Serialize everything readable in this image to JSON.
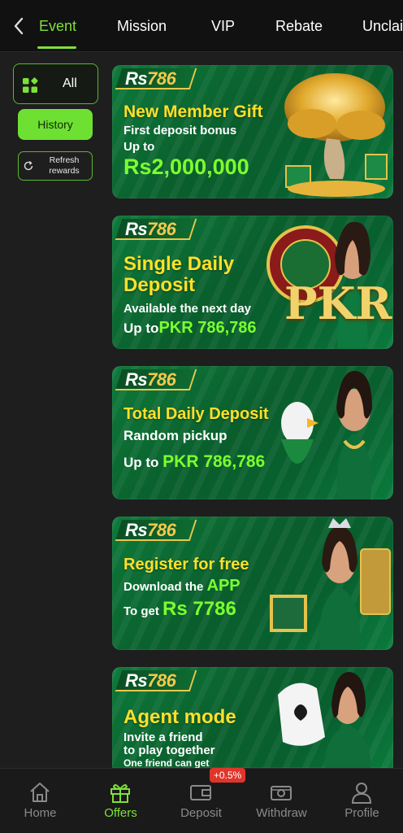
{
  "tabs": [
    {
      "label": "Event",
      "active": true
    },
    {
      "label": "Mission",
      "active": false
    },
    {
      "label": "VIP",
      "active": false
    },
    {
      "label": "Rebate",
      "active": false
    },
    {
      "label": "Unclai",
      "active": false
    }
  ],
  "filters": {
    "all_label": "All",
    "history_label": "History",
    "refresh_label": "Refresh rewards"
  },
  "brand": {
    "prefix": "Rs",
    "number": "786"
  },
  "banners": [
    {
      "title": "New Member Gift",
      "line1": "First deposit bonus",
      "line2": "Up to",
      "amount": "Rs2,000,000"
    },
    {
      "title1": "Single Daily",
      "title2": "Deposit",
      "line1": "Available the next day",
      "line2_prefix": "Up to",
      "amount": "PKR 786,786",
      "art_text": "PKR"
    },
    {
      "title": "Total Daily Deposit",
      "line1": "Random pickup",
      "line2_prefix": "Up to ",
      "amount": "PKR 786,786"
    },
    {
      "title": "Register for free",
      "line1_prefix": "Download the ",
      "line1_green": "APP",
      "line2_prefix": "To get ",
      "amount": "Rs 7786"
    },
    {
      "title": "Agent mode",
      "line1": "Invite a friend",
      "line2": "to play together",
      "line3": "One friend can get"
    }
  ],
  "bottom_nav": [
    {
      "label": "Home",
      "icon": "home-icon",
      "active": false
    },
    {
      "label": "Offers",
      "icon": "gift-icon",
      "active": true
    },
    {
      "label": "Deposit",
      "icon": "wallet-icon",
      "active": false
    },
    {
      "label": "Withdraw",
      "icon": "cash-icon",
      "active": false
    },
    {
      "label": "Profile",
      "icon": "person-icon",
      "active": false
    }
  ],
  "deposit_badge": "+0.5%",
  "colors": {
    "accent": "#7ee03a",
    "banner_green": "#0a6b33",
    "title_yellow": "#ffe02a",
    "badge_red": "#e0352a"
  }
}
